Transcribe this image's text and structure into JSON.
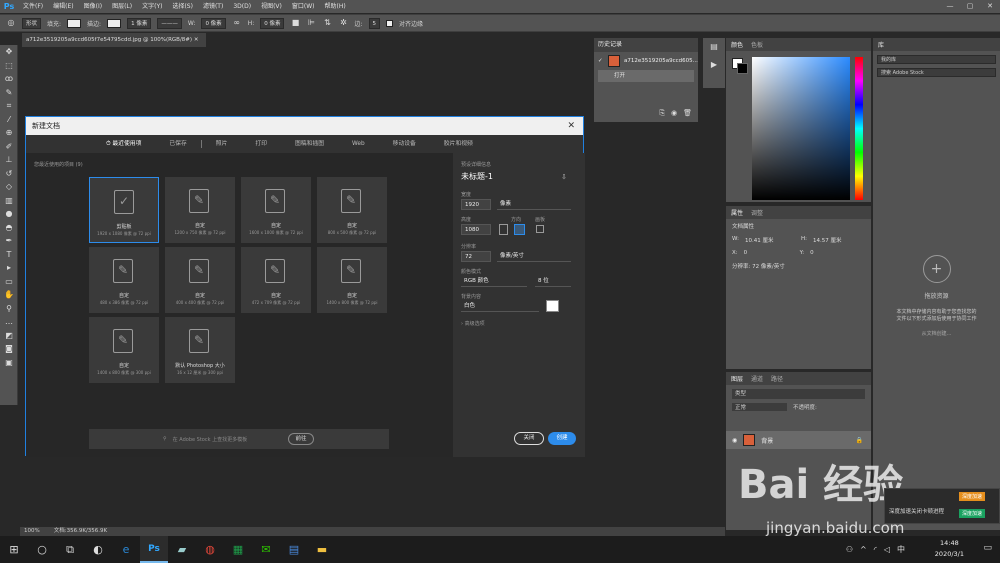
{
  "app": {
    "logo": "Ps",
    "menu": [
      "文件(F)",
      "编辑(E)",
      "图像(I)",
      "图层(L)",
      "文字(Y)",
      "选择(S)",
      "滤镜(T)",
      "3D(D)",
      "视图(V)",
      "窗口(W)",
      "帮助(H)"
    ],
    "window_buttons": [
      "—",
      "▢",
      "✕"
    ]
  },
  "options_bar": {
    "shape": "形状",
    "fill_label": "填充:",
    "stroke_label": "描边:",
    "stroke_width": "1 像素",
    "w_label": "W:",
    "w_value": "0 像素",
    "h_label": "H:",
    "h_value": "0 像素",
    "radius_label": "边:",
    "radius_value": "5",
    "align_edges": "对齐边缘"
  },
  "document": {
    "tab_title": "a712e3519205a9ccd605f7e54795cdd.jpg @ 100%(RGB/8#)",
    "zoom": "100%",
    "doc_size": "文档:356.9K/356.9K"
  },
  "history": {
    "tabs": [
      "历史记录"
    ],
    "snapshot": "a712e3519205a9ccd605...",
    "step": "打开"
  },
  "color_panel": {
    "tabs": [
      "颜色",
      "色板"
    ]
  },
  "properties": {
    "tabs": [
      "属性",
      "调整"
    ],
    "section": "文档属性",
    "w_label": "W:",
    "w_value": "10.41 厘米",
    "h_label": "H:",
    "h_value": "14.57 厘米",
    "x_label": "X:",
    "x_value": "0",
    "y_label": "Y:",
    "y_value": "0",
    "resolution": "分辨率: 72 像素/英寸"
  },
  "layers": {
    "tabs": [
      "图层",
      "通道",
      "路径"
    ],
    "search": "类型",
    "blend": "正常",
    "opacity": "不透明度:",
    "layer_name": "背景"
  },
  "library": {
    "tab": "库",
    "selector": "我的库",
    "search_placeholder": "搜索 Adobe Stock",
    "empty_title": "拖放资源",
    "empty_text1": "本文档中存储内容有助于您查找您的",
    "empty_text2": "文件以下形式添加后使用于协同工作",
    "empty_link": "从文档创建..."
  },
  "new_doc_dialog": {
    "title": "新建文档",
    "tabs": [
      "最近使用项",
      "已保存",
      "照片",
      "打印",
      "图稿和插图",
      "Web",
      "移动设备",
      "胶片和视频"
    ],
    "recent_label": "您最近使用的项目 (9)",
    "items": [
      {
        "name": "剪贴板",
        "size": "1920 x 1080 像素 @ 72 ppi"
      },
      {
        "name": "自定",
        "size": "1200 x 750 像素 @ 72 ppi"
      },
      {
        "name": "自定",
        "size": "1600 x 1000 像素 @ 72 ppi"
      },
      {
        "name": "自定",
        "size": "800 x 500 像素 @ 72 ppi"
      },
      {
        "name": "自定",
        "size": "480 x 386 像素 @ 72 ppi"
      },
      {
        "name": "自定",
        "size": "400 x 400 像素 @ 72 ppi"
      },
      {
        "name": "自定",
        "size": "472 x 709 像素 @ 72 ppi"
      },
      {
        "name": "自定",
        "size": "1400 x 800 像素 @ 72 ppi"
      },
      {
        "name": "自定",
        "size": "1400 x 800 像素 @ 300 ppi"
      },
      {
        "name": "默认 Photoshop 大小",
        "size": "16 x 12 厘米 @ 300 ppi"
      }
    ],
    "stock_search": "在 Adobe Stock 上查找更多模板",
    "go_button": "前往",
    "preset_label": "预设详细信息",
    "doc_name": "未标题-1",
    "width_label": "宽度",
    "width_value": "1920",
    "width_unit": "像素",
    "height_label": "高度",
    "orient_label": "方向",
    "artboard_label": "画板",
    "height_value": "1080",
    "res_label": "分辨率",
    "res_value": "72",
    "res_unit": "像素/英寸",
    "mode_label": "颜色模式",
    "mode_value": "RGB 颜色",
    "bits_value": "8 位",
    "bg_label": "背景内容",
    "bg_value": "白色",
    "advanced": "高级选项",
    "close_button": "关闭",
    "create_button": "创建"
  },
  "taskbar": {
    "time": "14:48",
    "date": "2020/3/1",
    "ime": "中"
  },
  "notification": {
    "line1": "深度加速",
    "line2": "深度加速关闭卡顿进程",
    "btn": "深度加速"
  },
  "watermark": {
    "brand": "Bai 经验",
    "url": "jingyan.baidu.com"
  }
}
